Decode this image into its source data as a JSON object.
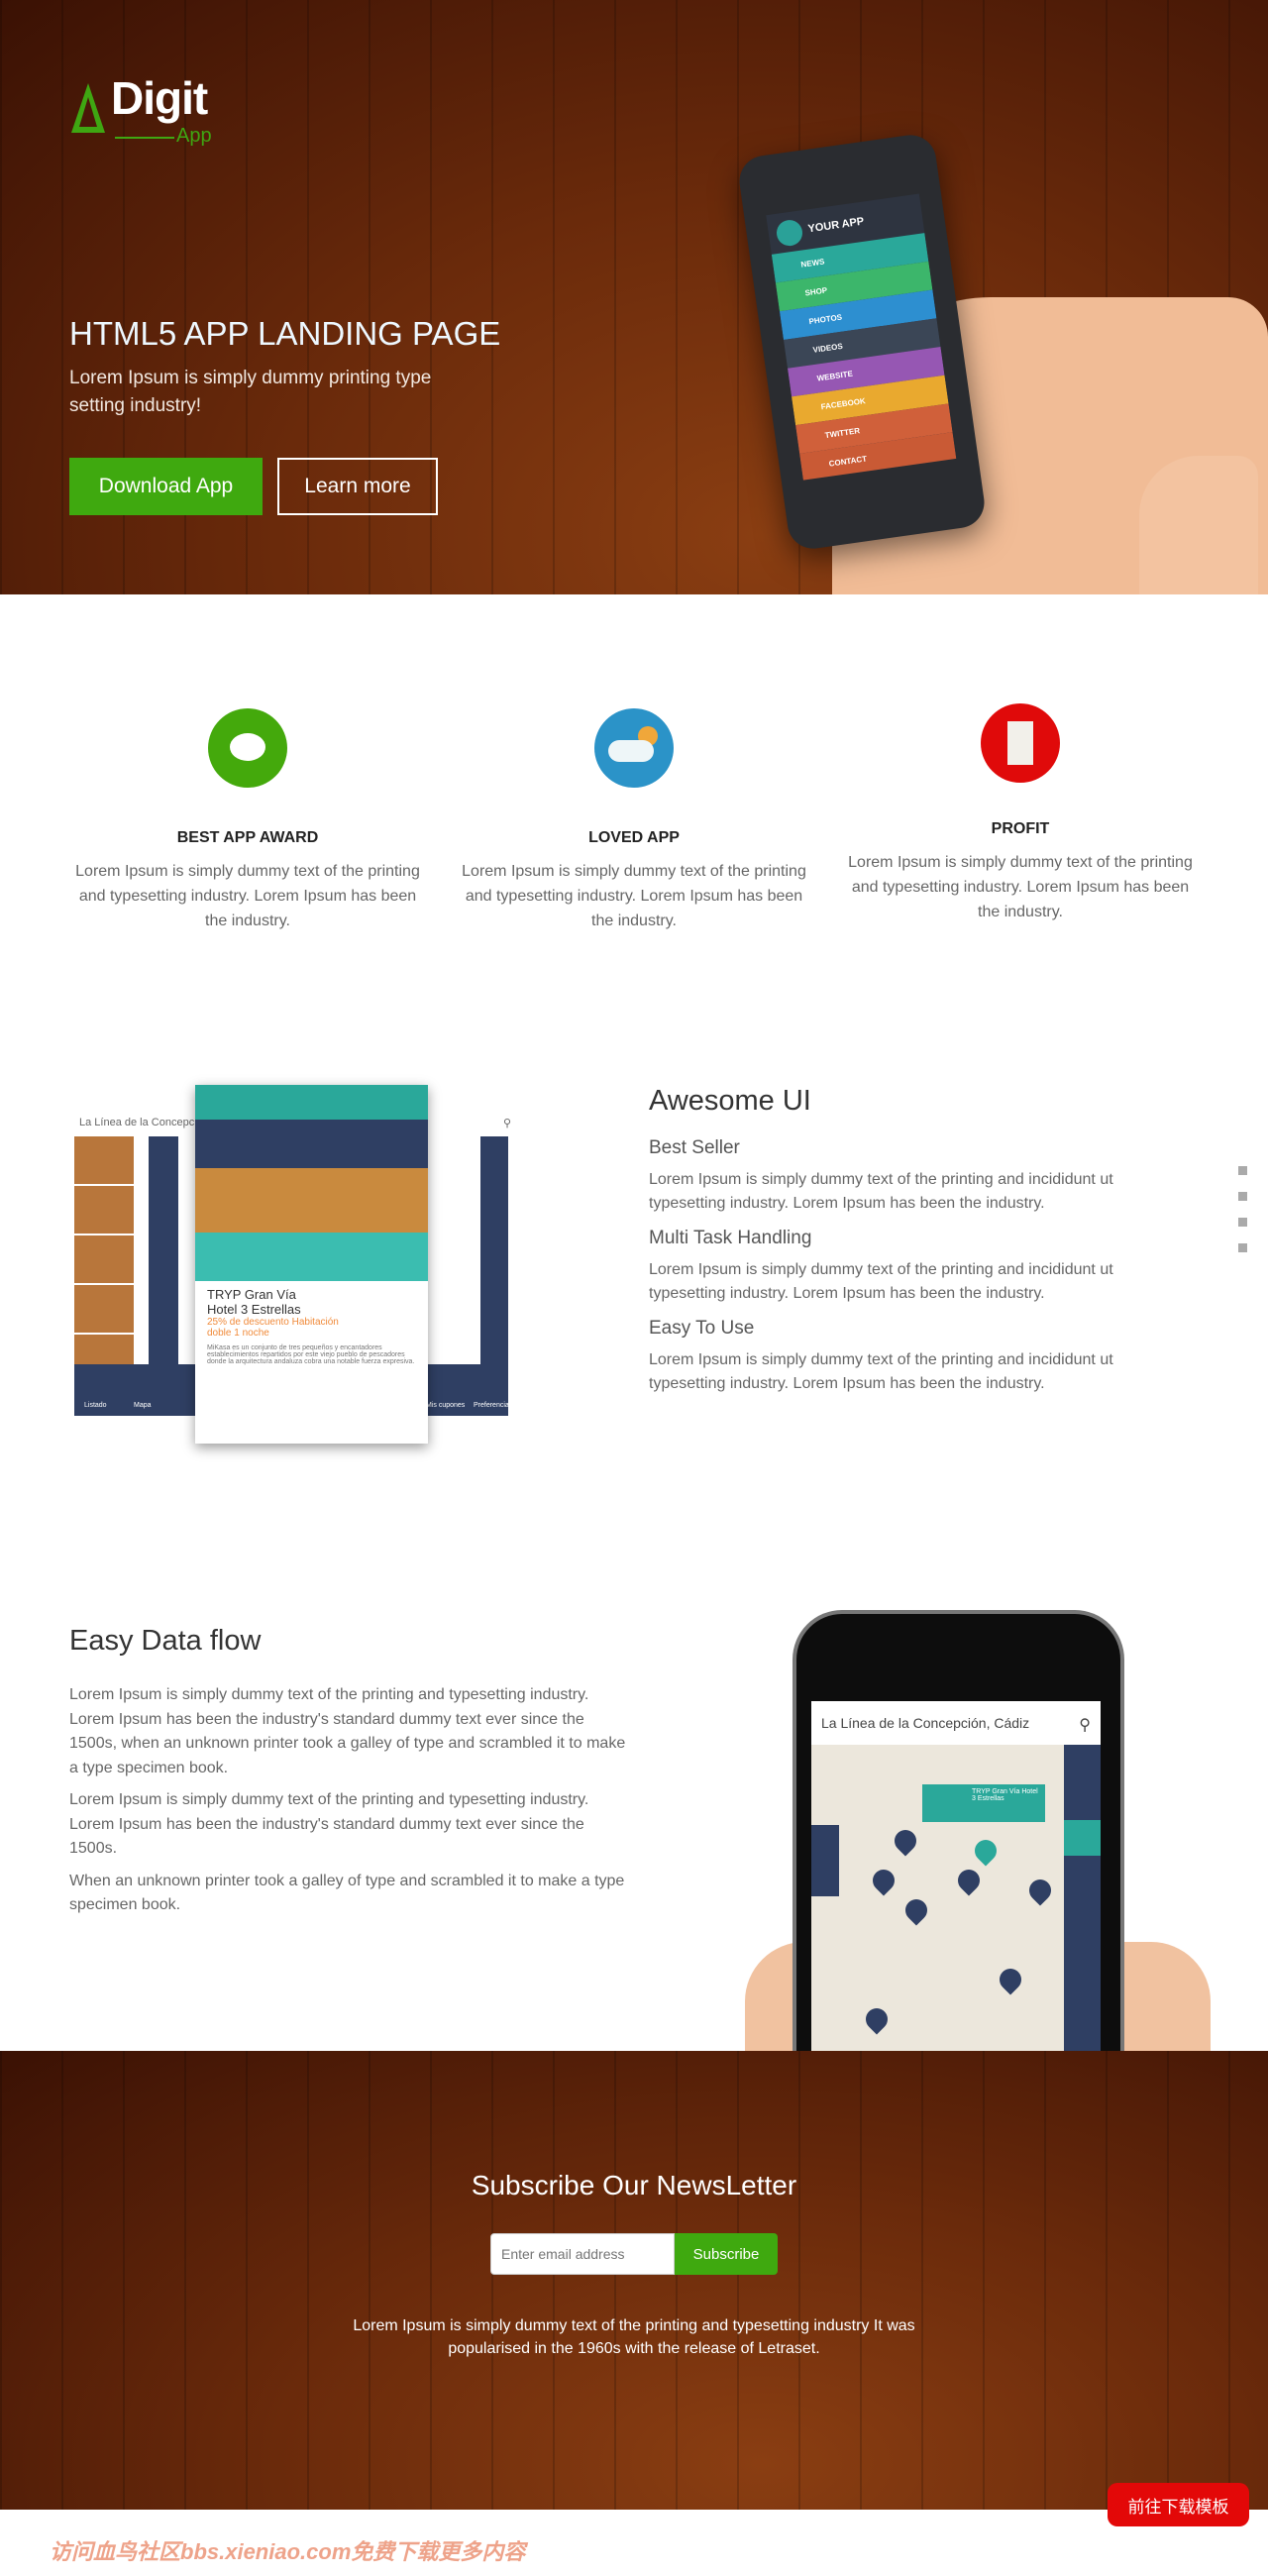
{
  "hero": {
    "logo_main": "Digit",
    "logo_sub": "App",
    "title": "HTML5 APP LANDING PAGE",
    "subtitle": "Lorem Ipsum is simply dummy printing type setting industry!",
    "download_label": "Download App",
    "learn_label": "Learn more",
    "phone": {
      "app_name": "YOUR APP",
      "menu": [
        {
          "label": "NEWS",
          "color": "#2aa89a"
        },
        {
          "label": "SHOP",
          "color": "#3cb66b"
        },
        {
          "label": "PHOTOS",
          "color": "#2d8fd0"
        },
        {
          "label": "VIDEOS",
          "color": "#3b4656"
        },
        {
          "label": "WEBSITE",
          "color": "#9657b3"
        },
        {
          "label": "FACEBOOK",
          "color": "#e9a92f"
        },
        {
          "label": "TWITTER",
          "color": "#d0603a"
        },
        {
          "label": "CONTACT",
          "color": "#c95a35"
        }
      ]
    }
  },
  "features": [
    {
      "title": "BEST APP AWARD",
      "text": "Lorem Ipsum is simply dummy text of the printing and typesetting industry. Lorem Ipsum has been the industry.",
      "icon": "chat-bubble-icon",
      "color": "#44a90c"
    },
    {
      "title": "LOVED APP",
      "text": "Lorem Ipsum is simply dummy text of the printing and typesetting industry. Lorem Ipsum has been the industry.",
      "icon": "cloud-sun-icon",
      "color": "#2b93c8"
    },
    {
      "title": "PROFIT",
      "text": "Lorem Ipsum is simply dummy text of the printing and typesetting industry. Lorem Ipsum has been the industry.",
      "icon": "shopping-bag-icon",
      "color": "#e00a0a"
    }
  ],
  "awesome": {
    "title": "Awesome UI",
    "items": [
      {
        "title": "Best Seller",
        "text": "Lorem Ipsum is simply dummy text of the printing and incididunt ut typesetting industry. Lorem Ipsum has been the industry."
      },
      {
        "title": "Multi Task Handling",
        "text": "Lorem Ipsum is simply dummy text of the printing and incididunt ut typesetting industry. Lorem Ipsum has been the industry."
      },
      {
        "title": "Easy To Use",
        "text": "Lorem Ipsum is simply dummy text of the printing and incididunt ut typesetting industry. Lorem Ipsum has been the industry."
      }
    ],
    "screenshot": {
      "search": "La Línea de la Concepción, Cádiz",
      "hotel_name": "TRYP Gran Vía Hotel 3 Estrellas",
      "offer": "25% de descuento Habitación doble 1 noche",
      "desc": "MiKasa es un conjunto de tres pequeños y encantadores establecimientos repartidos por este viejo pueblo de pescadores donde la arquitectura andaluza cobra una notable fuerza expresiva.",
      "tabs": [
        "Listado",
        "Mapa",
        "Mis cupones",
        "Preferencias"
      ]
    }
  },
  "dataflow": {
    "title": "Easy Data flow",
    "paragraphs": [
      "Lorem Ipsum is simply dummy text of the printing and typesetting industry. Lorem Ipsum has been the industry's standard dummy text ever since the 1500s, when an unknown printer took a galley of type and scrambled it to make a type specimen book.",
      "Lorem Ipsum is simply dummy text of the printing and typesetting industry. Lorem Ipsum has been the industry's standard dummy text ever since the 1500s.",
      "When an unknown printer took a galley of type and scrambled it to make a type specimen book."
    ],
    "phone": {
      "search": "La Línea de la Concepción, Cádiz",
      "popup": "TRYP Gran Vía Hotel 3 Estrellas"
    }
  },
  "newsletter": {
    "title": "Subscribe Our NewsLetter",
    "placeholder": "Enter email address",
    "button": "Subscribe",
    "text": "Lorem Ipsum is simply dummy text of the printing and typesetting industry It was popularised in the 1960s with the release of Letraset."
  },
  "download_button": "前往下载模板",
  "watermark": "访问血鸟社区bbs.xieniao.com免费下载更多内容",
  "colors": {
    "accent": "#3fa90f",
    "teal": "#2aa89a",
    "navy": "#2f3f63"
  }
}
